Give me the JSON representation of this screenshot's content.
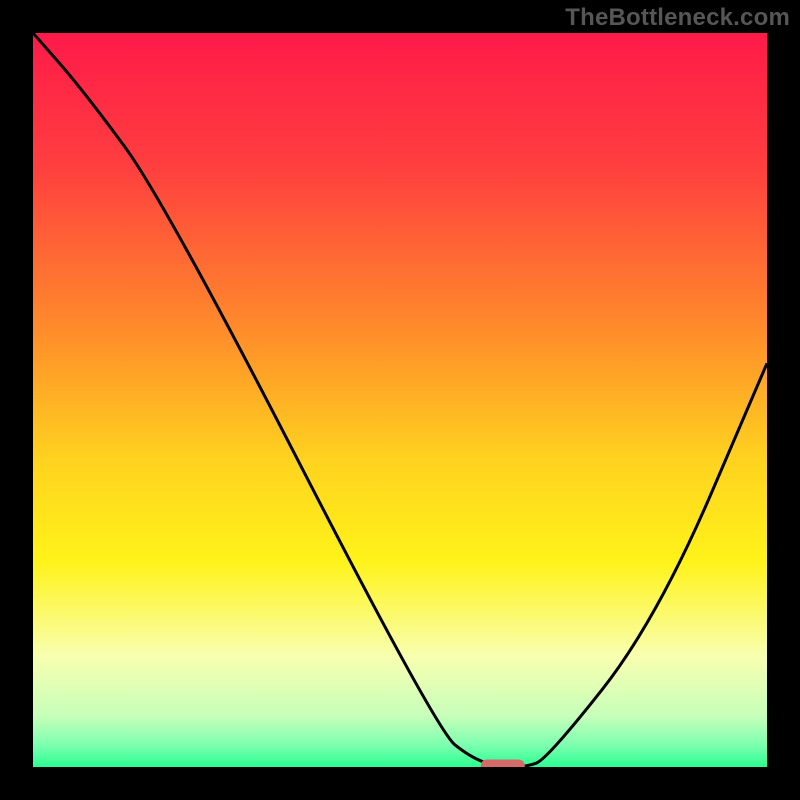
{
  "watermark": "TheBottleneck.com",
  "chart_data": {
    "type": "line",
    "title": "",
    "xlabel": "",
    "ylabel": "",
    "xlim": [
      0,
      100
    ],
    "ylim": [
      0,
      100
    ],
    "x": [
      0,
      7,
      18,
      55,
      60,
      64,
      67,
      70,
      85,
      100
    ],
    "values": [
      100,
      92,
      77,
      5,
      1,
      0,
      0,
      1,
      20,
      55
    ],
    "marker": {
      "x": 64,
      "y": 0,
      "width_pct": 6
    },
    "gradient_stops": [
      {
        "offset": 0.0,
        "color": "#ff1a49"
      },
      {
        "offset": 0.18,
        "color": "#ff3e3f"
      },
      {
        "offset": 0.4,
        "color": "#ff8a2b"
      },
      {
        "offset": 0.58,
        "color": "#ffd21f"
      },
      {
        "offset": 0.72,
        "color": "#fff31a"
      },
      {
        "offset": 0.85,
        "color": "#f8ffb0"
      },
      {
        "offset": 0.93,
        "color": "#c7ffba"
      },
      {
        "offset": 0.97,
        "color": "#7dffb0"
      },
      {
        "offset": 1.0,
        "color": "#2bff91"
      }
    ],
    "marker_color": "#d46a6a",
    "curve_color": "#000000",
    "curve_width": 3
  }
}
